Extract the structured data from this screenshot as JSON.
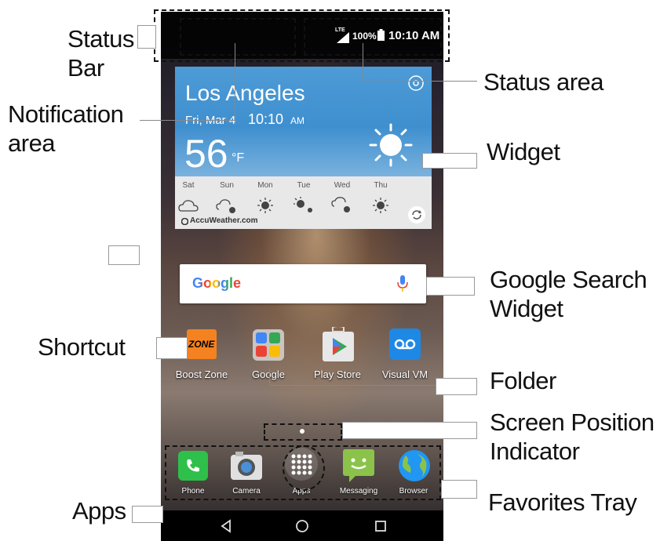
{
  "callouts": {
    "status_bar": "Status\nBar",
    "notification_area": "Notification\narea",
    "status_area": "Status area",
    "widget": "Widget",
    "google_search_widget": "Google Search\nWidget",
    "shortcut": "Shortcut",
    "folder": "Folder",
    "screen_position_indicator": "Screen Position\nIndicator",
    "apps": "Apps",
    "favorites_tray": "Favorites Tray"
  },
  "status_bar": {
    "network": "LTE",
    "battery": "100%",
    "time": "10:10 AM"
  },
  "weather": {
    "city": "Los Angeles",
    "date": "Fri, Mar 4",
    "time": "10:10",
    "ampm": "AM",
    "temperature": "56",
    "unit": "°F",
    "forecast": [
      {
        "day": "Sat",
        "icon": "cloud-icon"
      },
      {
        "day": "Sun",
        "icon": "cloud-sun-icon"
      },
      {
        "day": "Mon",
        "icon": "sun-icon"
      },
      {
        "day": "Tue",
        "icon": "sun-cloud-icon"
      },
      {
        "day": "Wed",
        "icon": "cloud-sun-icon"
      },
      {
        "day": "Thu",
        "icon": "sun-icon"
      }
    ],
    "provider": "AccuWeather.com"
  },
  "search": {
    "logo": "Google",
    "mic_icon": "microphone-icon"
  },
  "apps": [
    {
      "label": "Boost Zone",
      "icon": "boost-zone-icon"
    },
    {
      "label": "Google",
      "icon": "google-folder-icon"
    },
    {
      "label": "Play Store",
      "icon": "play-store-icon"
    },
    {
      "label": "Visual VM",
      "icon": "voicemail-icon"
    }
  ],
  "tray": [
    {
      "label": "Phone",
      "icon": "phone-icon"
    },
    {
      "label": "Camera",
      "icon": "camera-icon"
    },
    {
      "label": "Apps",
      "icon": "apps-grid-icon"
    },
    {
      "label": "Messaging",
      "icon": "messaging-icon"
    },
    {
      "label": "Browser",
      "icon": "browser-icon"
    }
  ],
  "navbar": [
    "back-icon",
    "home-icon",
    "recents-icon"
  ],
  "colors": {
    "weather_blue": "#4d9bd6",
    "phone_green": "#2ec04a",
    "messaging_green": "#8bc34a",
    "vvm_blue": "#1e88e5",
    "boost_orange": "#f58220"
  }
}
